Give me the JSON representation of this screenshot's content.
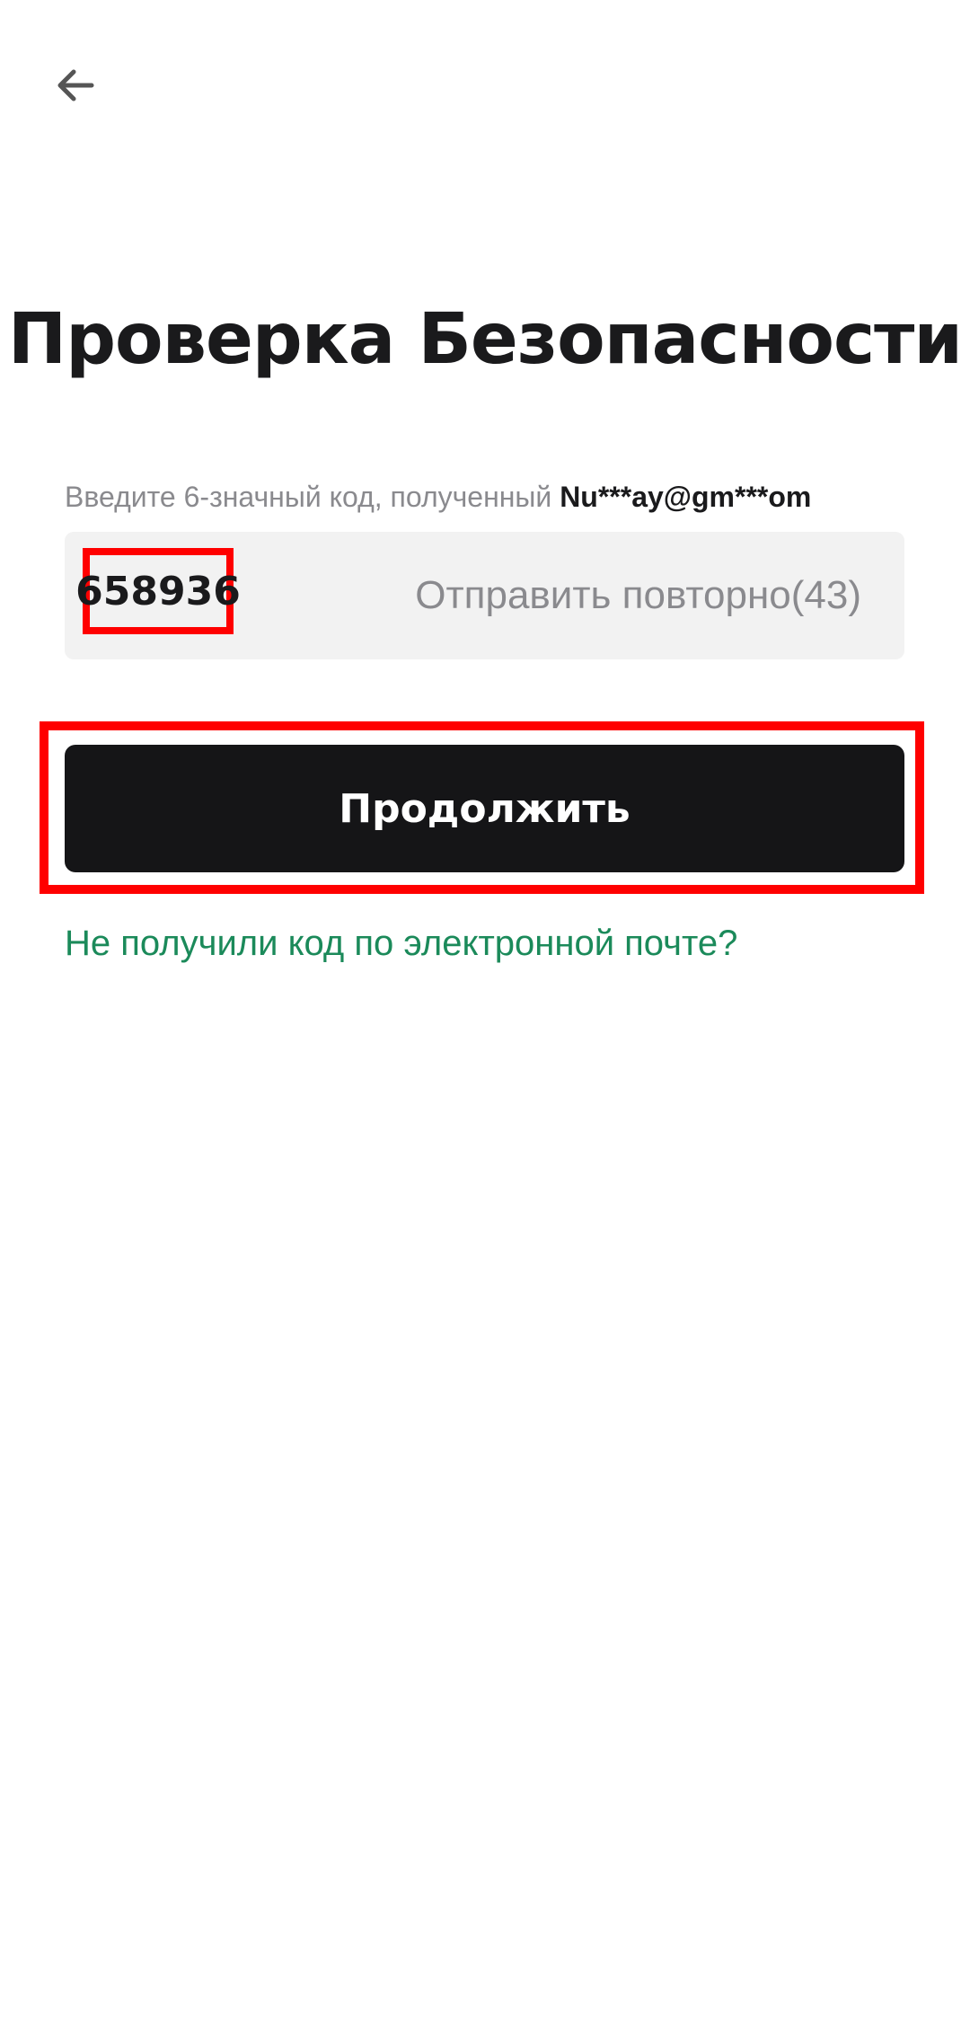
{
  "header": {
    "back_icon": "arrow-left-icon"
  },
  "page": {
    "title": "Проверка Безопасности"
  },
  "verification": {
    "hint_prefix": "Введите 6-значный код, полученный ",
    "masked_email": "Nu***ay@gm***om",
    "code_value": "658936",
    "resend_label": "Отправить повторно(43)"
  },
  "actions": {
    "continue_label": "Продолжить",
    "no_code_link": "Не получили код по электронной почте?"
  },
  "colors": {
    "primary_button": "#151517",
    "link": "#1b8a5a",
    "highlight": "#ff0000",
    "field_background": "#f2f2f2"
  }
}
